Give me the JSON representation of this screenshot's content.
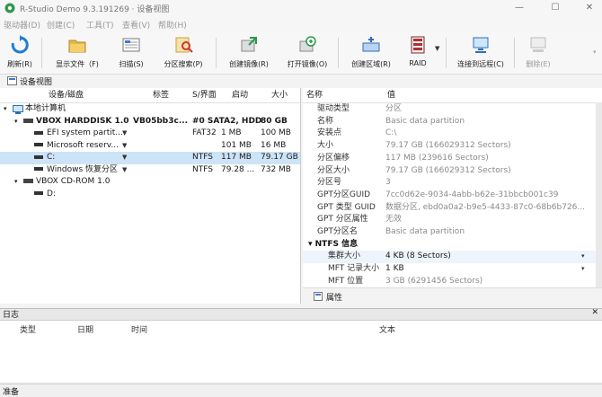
{
  "window": {
    "title": "R-Studio Demo 9.3.191269 · 设备视图"
  },
  "menu": [
    "驱动器(D)",
    "创建(C)",
    "工具(T)",
    "查看(V)",
    "帮助(H)"
  ],
  "toolbar": {
    "refresh": "刷新(R)",
    "show_files": "显示文件（F)",
    "scan": "扫描(S)",
    "partition_search": "分区搜索(P)",
    "create_image": "创建镜像(R)",
    "open_image": "打开镜像(O)",
    "create_region": "创建区域(R)",
    "raid": "RAID",
    "connect_remote": "连接到远程(C)",
    "delete": "删除(E)"
  },
  "device_view": {
    "title": "设备视图",
    "columns": {
      "device": "设备/磁盘",
      "label": "标签",
      "interface": "S/界面",
      "start": "启动",
      "size": "大小"
    },
    "rows": [
      {
        "indent": 0,
        "icon": "computer",
        "name": "本地计算机",
        "label": "",
        "iface": "",
        "start": "",
        "size": "",
        "bold": false
      },
      {
        "indent": 1,
        "icon": "disk",
        "name": "VBOX HARDDISK 1.0",
        "label": "VB05bb3c...",
        "iface": "#0 SATA2, HDD",
        "start": "",
        "size": "80 GB",
        "bold": true
      },
      {
        "indent": 2,
        "icon": "partition",
        "name": "EFI system partit...",
        "label": "",
        "iface": "FAT32",
        "start": "1 MB",
        "size": "100 MB",
        "bold": false
      },
      {
        "indent": 2,
        "icon": "partition",
        "name": "Microsoft reserv...",
        "label": "",
        "iface": "",
        "start": "101 MB",
        "size": "16 MB",
        "bold": false
      },
      {
        "indent": 2,
        "icon": "partition",
        "name": "C:",
        "label": "",
        "iface": "NTFS",
        "start": "117 MB",
        "size": "79.17 GB",
        "bold": false,
        "selected": true
      },
      {
        "indent": 2,
        "icon": "partition",
        "name": "Windows 恢复分区",
        "label": "",
        "iface": "NTFS",
        "start": "79.28 ...",
        "size": "732 MB",
        "bold": false
      },
      {
        "indent": 1,
        "icon": "disk",
        "name": "VBOX CD-ROM 1.0",
        "label": "",
        "iface": "",
        "start": "",
        "size": "",
        "bold": false
      },
      {
        "indent": 2,
        "icon": "partition",
        "name": "D:",
        "label": "",
        "iface": "",
        "start": "",
        "size": "",
        "bold": false
      }
    ]
  },
  "properties": {
    "columns": {
      "name": "名称",
      "value": "值"
    },
    "rows": [
      {
        "name": "驱动类型",
        "value": "分区",
        "dark": false
      },
      {
        "name": "名称",
        "value": "Basic data partition",
        "dark": false
      },
      {
        "name": "安装点",
        "value": "C:\\",
        "dark": false
      },
      {
        "name": "大小",
        "value": "79.17 GB (166029312 Sectors)",
        "dark": false
      },
      {
        "name": "分区偏移",
        "value": "117 MB (239616 Sectors)",
        "dark": false
      },
      {
        "name": "分区大小",
        "value": "79.17 GB (166029312 Sectors)",
        "dark": false
      },
      {
        "name": "分区号",
        "value": "3",
        "dark": false
      },
      {
        "name": "GPT分区GUID",
        "value": "7cc0d62e-9034-4abb-b62e-31bbcb001c39",
        "dark": false
      },
      {
        "name": "GPT 类型 GUID",
        "value": "数据分区, ebd0a0a2-b9e5-4433-87c0-68b6b726...",
        "dark": false
      },
      {
        "name": "GPT 分区属性",
        "value": "无效",
        "dark": false
      },
      {
        "name": "GPT分区名",
        "value": "Basic data partition",
        "dark": false
      },
      {
        "name": "NTFS 信息",
        "value": "",
        "dark": true,
        "group": true
      },
      {
        "name": "集群大小",
        "value": "4 KB (8 Sectors)",
        "dark": true,
        "sub": true,
        "hl": true
      },
      {
        "name": "MFT 记录大小",
        "value": "1 KB",
        "dark": true,
        "sub": true
      },
      {
        "name": "MFT 位置",
        "value": "3 GB (6291456 Sectors)",
        "dark": false,
        "sub": true
      }
    ],
    "tab": "属性"
  },
  "log": {
    "title": "日志",
    "columns": {
      "type": "类型",
      "date": "日期",
      "time": "时间",
      "text": "文本"
    }
  },
  "status": "准备"
}
